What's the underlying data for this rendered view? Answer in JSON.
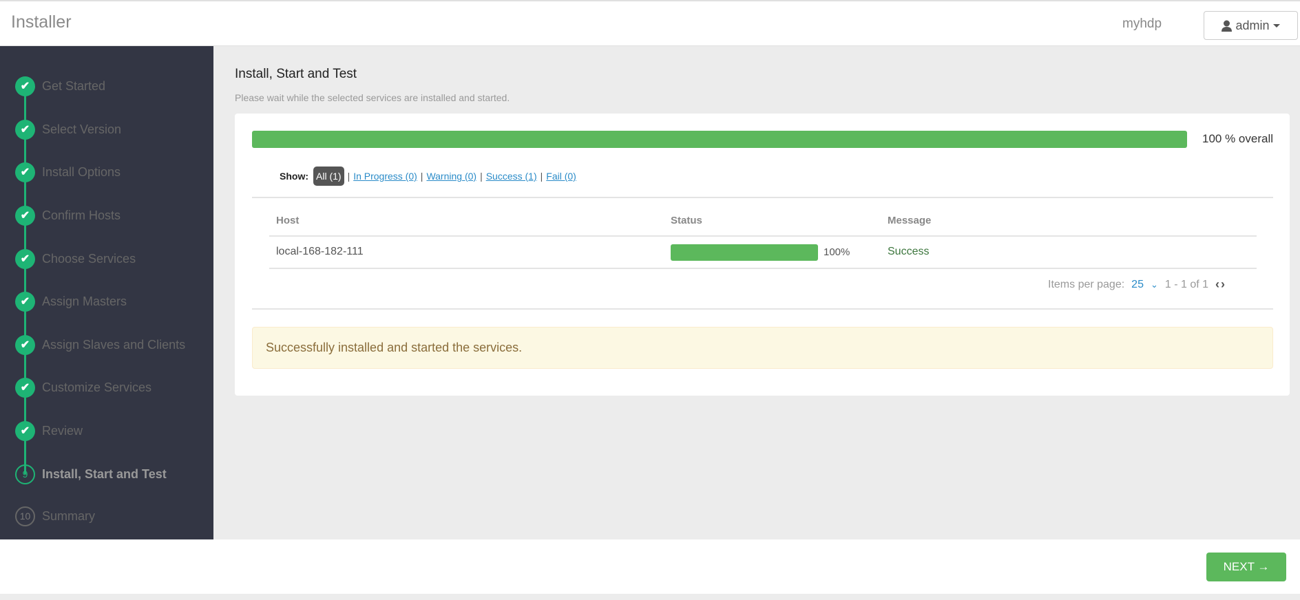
{
  "header": {
    "title": "Installer",
    "cluster": "myhdp",
    "user": "admin"
  },
  "sidebar": {
    "steps": [
      {
        "label": "Get Started",
        "state": "done"
      },
      {
        "label": "Select Version",
        "state": "done"
      },
      {
        "label": "Install Options",
        "state": "done"
      },
      {
        "label": "Confirm Hosts",
        "state": "done"
      },
      {
        "label": "Choose Services",
        "state": "done"
      },
      {
        "label": "Assign Masters",
        "state": "done"
      },
      {
        "label": "Assign Slaves and Clients",
        "state": "done"
      },
      {
        "label": "Customize Services",
        "state": "done"
      },
      {
        "label": "Review",
        "state": "done"
      },
      {
        "label": "Install, Start and Test",
        "state": "current",
        "number": "9"
      },
      {
        "label": "Summary",
        "state": "todo",
        "number": "10"
      }
    ]
  },
  "main": {
    "title": "Install, Start and Test",
    "subtitle": "Please wait while the selected services are installed and started.",
    "overall_progress": 100,
    "overall_text": "100 % overall",
    "filter": {
      "label": "Show:",
      "options": [
        "All (1)",
        "In Progress (0)",
        "Warning (0)",
        "Success (1)",
        "Fail (0)"
      ],
      "selected": "All (1)"
    },
    "table": {
      "columns": [
        "Host",
        "Status",
        "Message"
      ],
      "rows": [
        {
          "host": "local-168-182-111",
          "progress": 100,
          "progress_text": "100%",
          "message": "Success"
        }
      ]
    },
    "pager": {
      "items_label": "Items per page:",
      "per_page": "25",
      "range": "1 - 1 of 1"
    },
    "alert": "Successfully installed and started the services."
  },
  "footer": {
    "next_label": "NEXT →"
  },
  "colors": {
    "accent": "#1eb475",
    "progress": "#5cb85c",
    "sidebar": "#333644"
  }
}
